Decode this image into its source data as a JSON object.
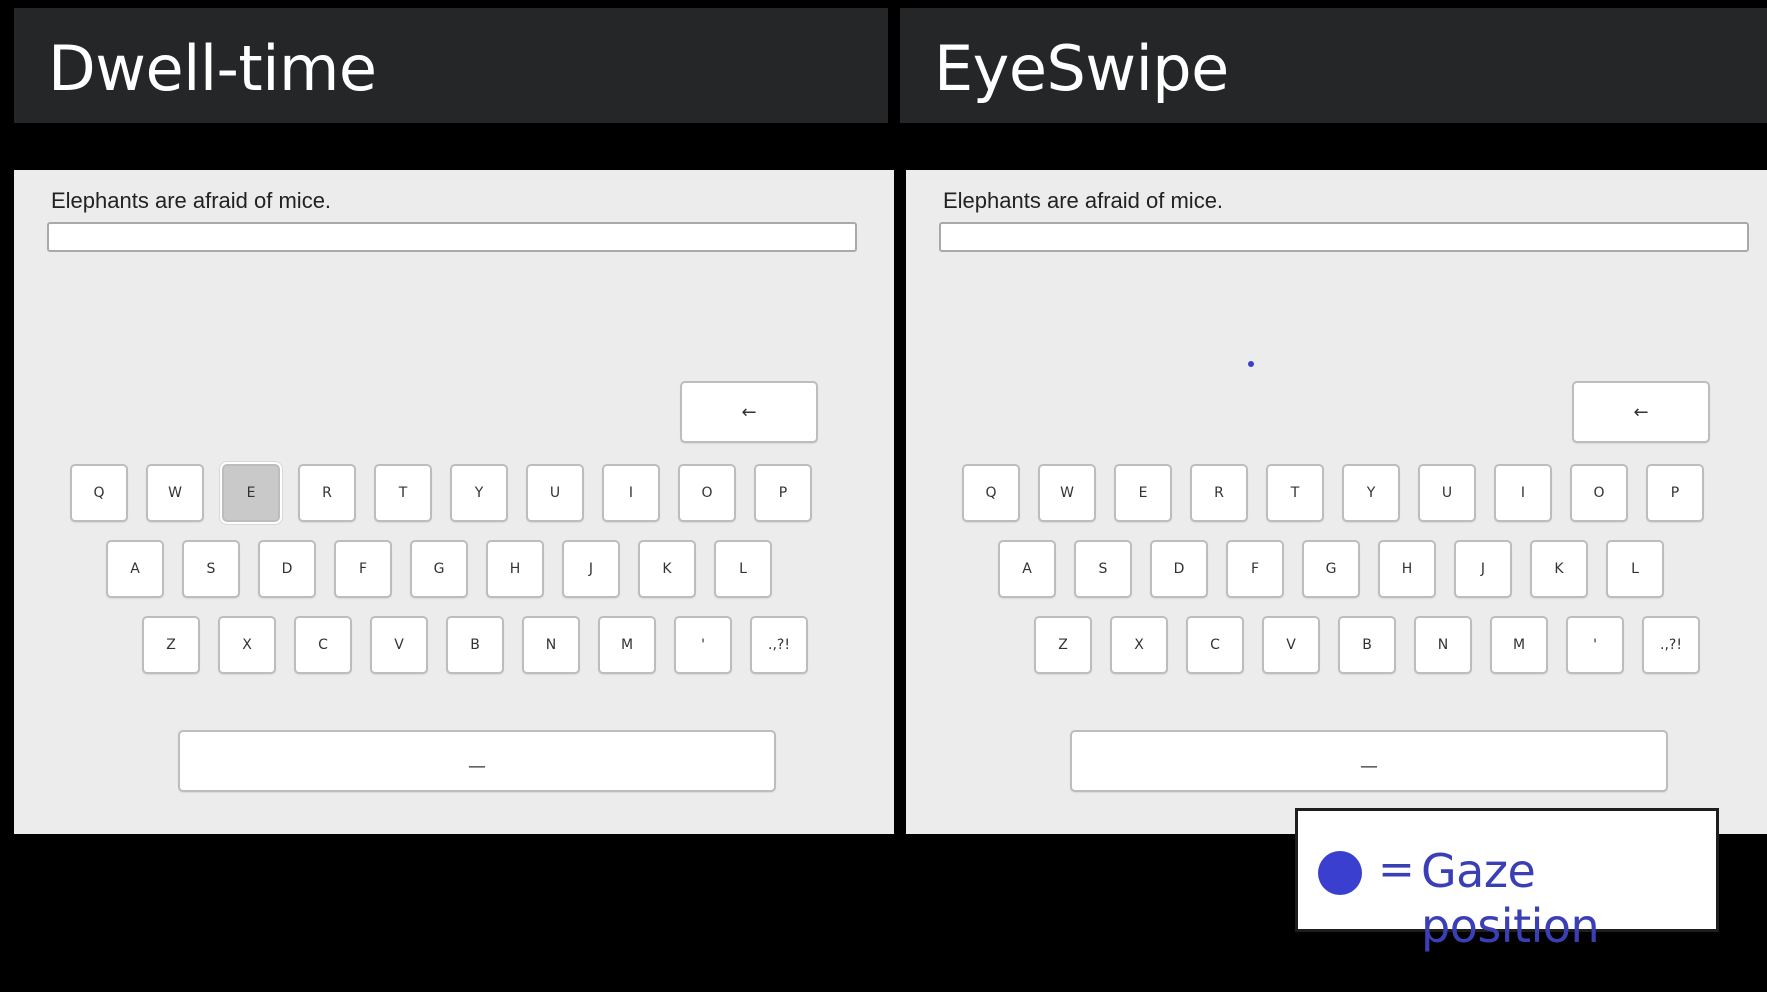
{
  "panels": [
    {
      "title": "Dwell-time",
      "prompt": "Elephants are afraid of mice.",
      "typed_text": "",
      "dwell_key": "E",
      "show_gaze_dot": false
    },
    {
      "title": "EyeSwipe",
      "prompt": "Elephants are afraid of mice.",
      "typed_text": "",
      "dwell_key": "",
      "show_gaze_dot": true
    }
  ],
  "keyboard": {
    "rows": [
      [
        "Q",
        "W",
        "E",
        "R",
        "T",
        "Y",
        "U",
        "I",
        "O",
        "P"
      ],
      [
        "A",
        "S",
        "D",
        "F",
        "G",
        "H",
        "J",
        "K",
        "L"
      ],
      [
        "Z",
        "X",
        "C",
        "V",
        "B",
        "N",
        "M",
        "'",
        ".,?!"
      ]
    ],
    "backspace_label": "←",
    "space_label": "—"
  },
  "legend": {
    "equals": "=",
    "label": "Gaze position"
  },
  "colors": {
    "gaze": "#3a3fcf",
    "legend_text": "#3a3fb5",
    "legend_equals": "#3a3fb5"
  }
}
